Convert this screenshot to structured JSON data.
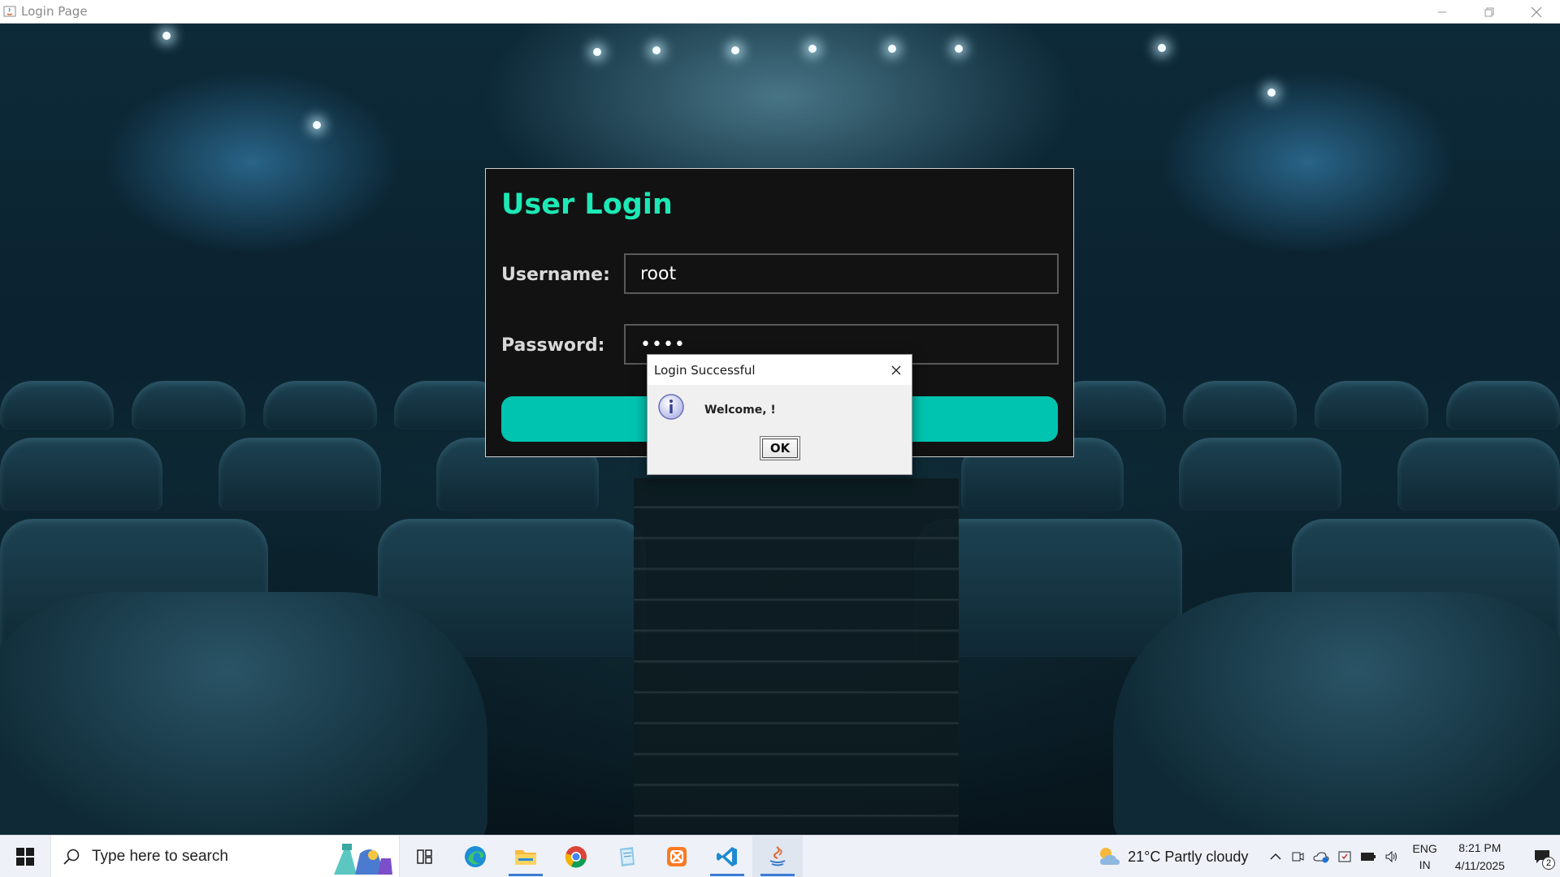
{
  "window": {
    "title": "Login Page"
  },
  "login": {
    "title": "User Login",
    "username_label": "Username:",
    "username_value": "root",
    "password_label": "Password:",
    "password_value": "••••",
    "accent_color": "#1de9b6",
    "button_color": "#00c4b0"
  },
  "dialog": {
    "title": "Login Successful",
    "message": "Welcome, !",
    "ok_label": "OK"
  },
  "taskbar": {
    "search_placeholder": "Type here to search",
    "apps": [
      "task-view-icon",
      "edge-icon",
      "file-explorer-icon",
      "chrome-icon",
      "notepad-icon",
      "xampp-icon",
      "vscode-icon",
      "java-icon"
    ],
    "weather": "21°C  Partly cloudy",
    "lang_line1": "ENG",
    "lang_line2": "IN",
    "time": "8:21 PM",
    "date": "4/11/2025",
    "notification_count": "2"
  }
}
